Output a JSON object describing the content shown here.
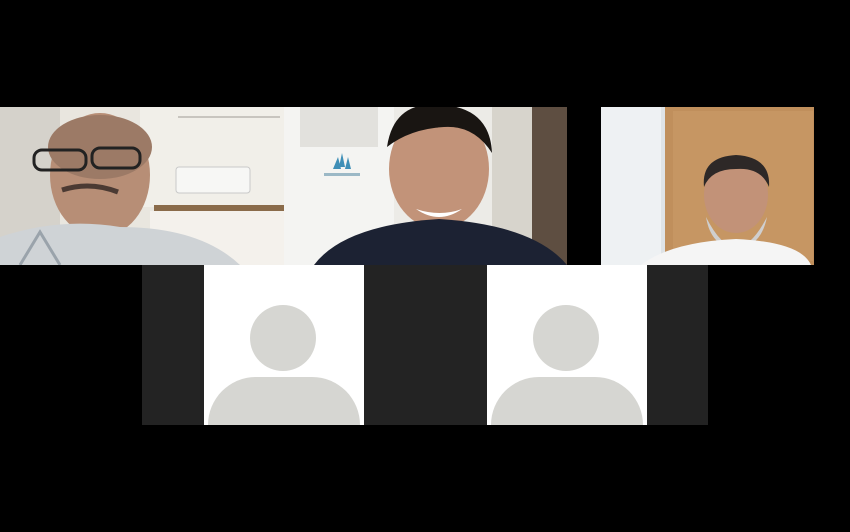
{
  "meeting": {
    "video_participants": [
      {
        "id": "participant-1",
        "feed": "video"
      },
      {
        "id": "participant-2",
        "feed": "video"
      },
      {
        "id": "participant-3",
        "feed": "video"
      }
    ],
    "avatar_participants": [
      {
        "id": "participant-4",
        "feed": "avatar-placeholder"
      },
      {
        "id": "participant-5",
        "feed": "avatar-placeholder"
      }
    ]
  },
  "colors": {
    "background": "#000000",
    "empty_tile": "#232323",
    "avatar_tile": "#ffffff",
    "avatar_silhouette": "#d6d6d2"
  }
}
